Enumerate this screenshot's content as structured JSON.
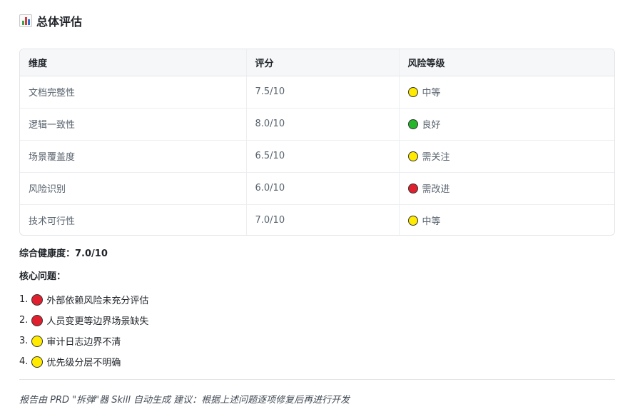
{
  "report": {
    "title": "总体评估",
    "title_icon": "bar-chart-icon"
  },
  "table": {
    "headers": [
      "维度",
      "评分",
      "风险等级"
    ],
    "rows": [
      {
        "dimension": "文档完整性",
        "score": "7.5/10",
        "risk": "中等",
        "risk_color": "yellow"
      },
      {
        "dimension": "逻辑一致性",
        "score": "8.0/10",
        "risk": "良好",
        "risk_color": "green"
      },
      {
        "dimension": "场景覆盖度",
        "score": "6.5/10",
        "risk": "需关注",
        "risk_color": "yellow"
      },
      {
        "dimension": "风险识别",
        "score": "6.0/10",
        "risk": "需改进",
        "risk_color": "red"
      },
      {
        "dimension": "技术可行性",
        "score": "7.0/10",
        "risk": "中等",
        "risk_color": "yellow"
      }
    ]
  },
  "summary": {
    "health_label": "综合健康度：7.0/10",
    "core_issues_label": "核心问题："
  },
  "issues": [
    {
      "num": "1.",
      "color": "red",
      "text": "外部依赖风险未充分评估"
    },
    {
      "num": "2.",
      "color": "red",
      "text": "人员变更等边界场景缺失"
    },
    {
      "num": "3.",
      "color": "yellow",
      "text": "审计日志边界不清"
    },
    {
      "num": "4.",
      "color": "yellow",
      "text": "优先级分层不明确"
    }
  ],
  "footer": {
    "text": "报告由 PRD \"拆弹\"器 Skill 自动生成 建议：根据上述问题逐项修复后再进行开发"
  },
  "colors": {
    "yellow": "#ffea00",
    "green": "#25b72a",
    "red": "#e0202f"
  }
}
